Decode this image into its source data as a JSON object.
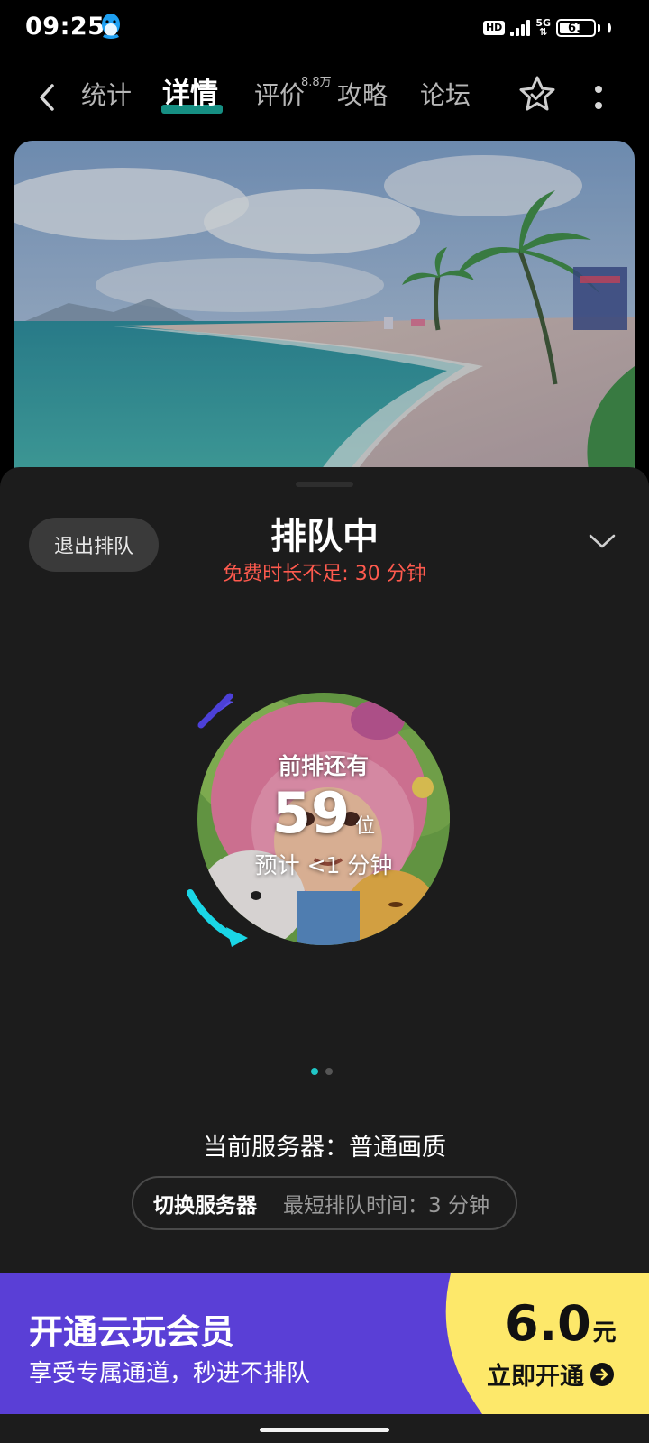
{
  "status_bar": {
    "time": "09:25",
    "hd": "HD",
    "network": "5G",
    "battery": "61",
    "battery_fraction": 0.61,
    "icons": [
      "qq-penguin-icon",
      "signal-icon",
      "battery-icon",
      "leaf-icon"
    ]
  },
  "nav": {
    "tabs": [
      {
        "label": "统计"
      },
      {
        "label": "详情",
        "active": true
      },
      {
        "label": "评价",
        "badge": "8.8万"
      },
      {
        "label": "攻略"
      },
      {
        "label": "论坛"
      }
    ],
    "icons": [
      "back-icon",
      "star-icon",
      "more-icon"
    ]
  },
  "queue_sheet": {
    "exit_label": "退出排队",
    "title": "排队中",
    "subtitle": "免费时长不足: 30 分钟",
    "ahead_label": "前排还有",
    "count": "59",
    "unit": "位",
    "eta": "预计 <1 分钟",
    "pager_total": 2,
    "pager_active": 0,
    "server_line": "当前服务器：普通画质",
    "switch_label": "切换服务器",
    "min_wait": "最短排队时间：3 分钟"
  },
  "promo": {
    "title": "开通云玩会员",
    "subtitle": "享受专属通道，秒进不排队",
    "price": "6.0",
    "price_unit": "元",
    "cta": "立即开通"
  },
  "colors": {
    "accent_teal": "#1aa89a",
    "warning_red": "#ff5a4e",
    "promo_purple": "#5a3fd6",
    "promo_yellow": "#fde86a",
    "sheet_bg": "#1c1c1c"
  }
}
